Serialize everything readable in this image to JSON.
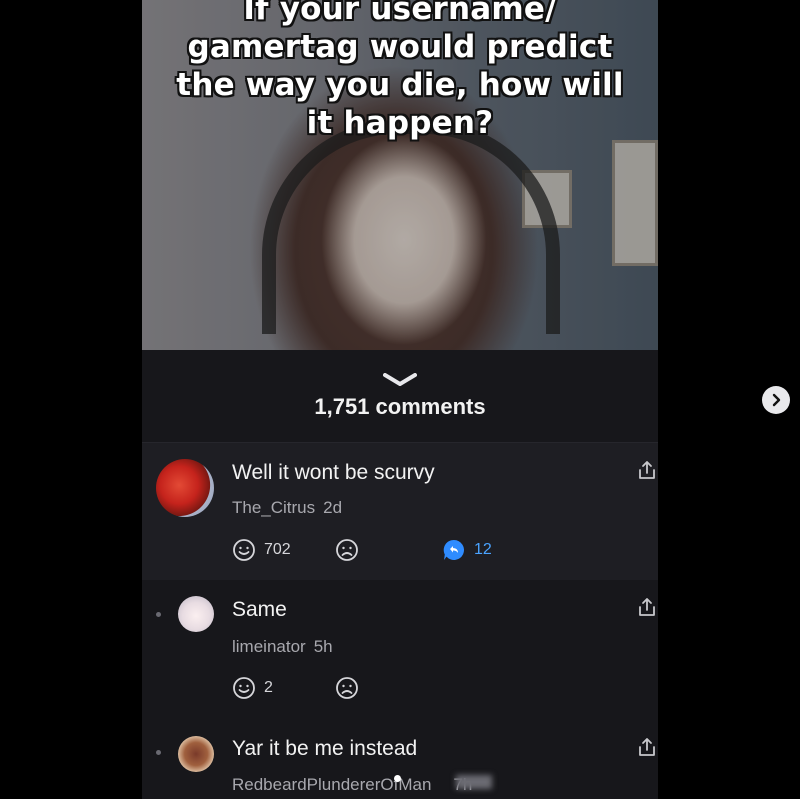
{
  "post": {
    "caption": "If your username/ gamertag would predict the way you die, how will it happen?",
    "comments_count": "1,751 comments"
  },
  "comments": [
    {
      "text": "Well it wont be scurvy",
      "username": "The_Citrus",
      "time": "2d",
      "likes": "702",
      "replies": "12"
    },
    {
      "text": "Same",
      "username": "limeinator",
      "time": "5h",
      "likes": "2"
    },
    {
      "text": "Yar it be me instead",
      "username": "RedbeardPlundererOfMan",
      "time": "7h"
    }
  ],
  "icons": {
    "collapse": "chevron-down-icon",
    "like": "smile-icon",
    "dislike": "frown-icon",
    "reply": "reply-bubble-icon",
    "share": "share-icon",
    "next": "chevron-right-icon"
  },
  "colors": {
    "panel_bg": "#17171b",
    "highlight_bg": "#1e1e23",
    "reply_accent": "#4aa3ff",
    "muted_text": "#a8a8ae"
  }
}
